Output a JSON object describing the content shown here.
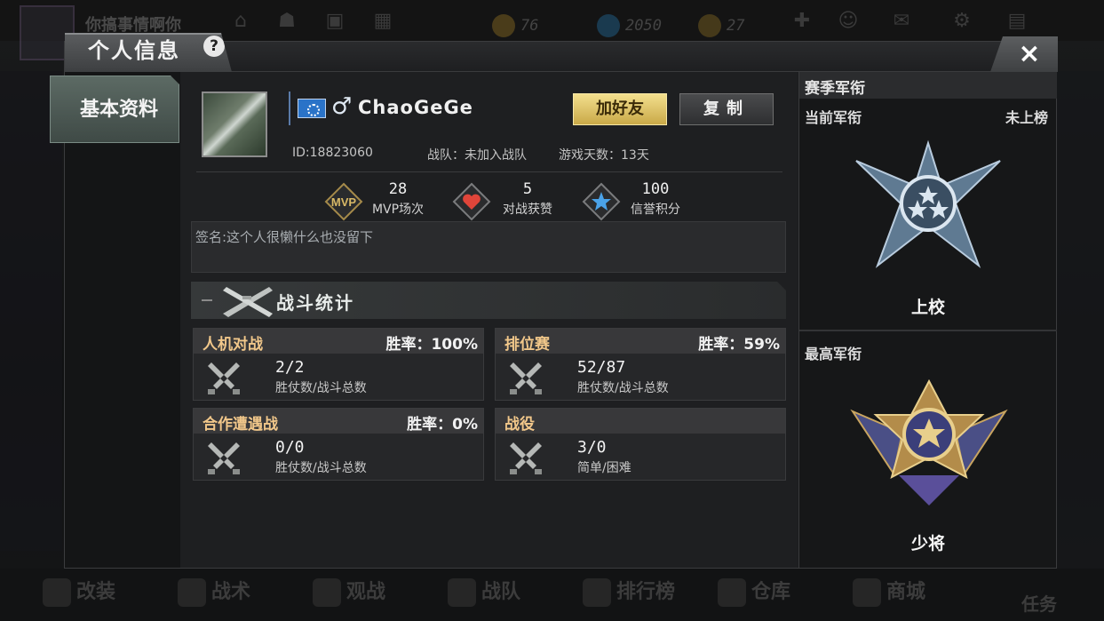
{
  "background": {
    "title": "你搞事情啊你",
    "resources": [
      {
        "value": "76",
        "icon": "coin-icon",
        "color": "#c89a2a"
      },
      {
        "value": "2050",
        "icon": "diamond-icon",
        "color": "#2a8ac8"
      },
      {
        "value": "27",
        "icon": "ticket-icon",
        "color": "#c8a82a"
      }
    ],
    "nav": [
      {
        "label": "改装",
        "icon": "wrench-icon"
      },
      {
        "label": "战术",
        "icon": "skull-icon"
      },
      {
        "label": "观战",
        "icon": "star-icon"
      },
      {
        "label": "战队",
        "icon": "shield-icon"
      },
      {
        "label": "排行榜",
        "icon": "trophy-icon"
      },
      {
        "label": "仓库",
        "icon": "warehouse-icon"
      },
      {
        "label": "商城",
        "icon": "shop-icon"
      },
      {
        "label": "任务",
        "icon": "task-icon"
      }
    ]
  },
  "modal": {
    "title": "个人信息",
    "help": "?",
    "close": "×",
    "side_tab": "基本资料"
  },
  "profile": {
    "gender": "♂",
    "name": "ChaoGeGe",
    "add_friend": "加好友",
    "copy": "复制",
    "id": "ID:18823060",
    "team": "战队：未加入战队",
    "days": "游戏天数：13天",
    "stats": [
      {
        "value": "28",
        "label": "MVP场次",
        "icon": "mvp-icon"
      },
      {
        "value": "5",
        "label": "对战获赞",
        "icon": "heart-icon"
      },
      {
        "value": "100",
        "label": "信誉积分",
        "icon": "star-badge-icon"
      }
    ],
    "signature": "签名:这个人很懒什么也没留下",
    "section_title": "战斗统计"
  },
  "battle_cards": [
    {
      "title": "人机对战",
      "rate": "胜率：100%",
      "value": "2/2",
      "sub": "胜仗数/战斗总数"
    },
    {
      "title": "排位赛",
      "rate": "胜率：59%",
      "value": "52/87",
      "sub": "胜仗数/战斗总数"
    },
    {
      "title": "合作遭遇战",
      "rate": "胜率：0%",
      "value": "0/0",
      "sub": "胜仗数/战斗总数"
    },
    {
      "title": "战役",
      "rate": "",
      "value": "3/0",
      "sub": "简单/困难"
    }
  ],
  "rank": {
    "header": "赛季军衔",
    "current_label": "当前军衔",
    "current_status": "未上榜",
    "current_rank": "上校",
    "highest_label": "最高军衔",
    "highest_rank": "少将"
  }
}
